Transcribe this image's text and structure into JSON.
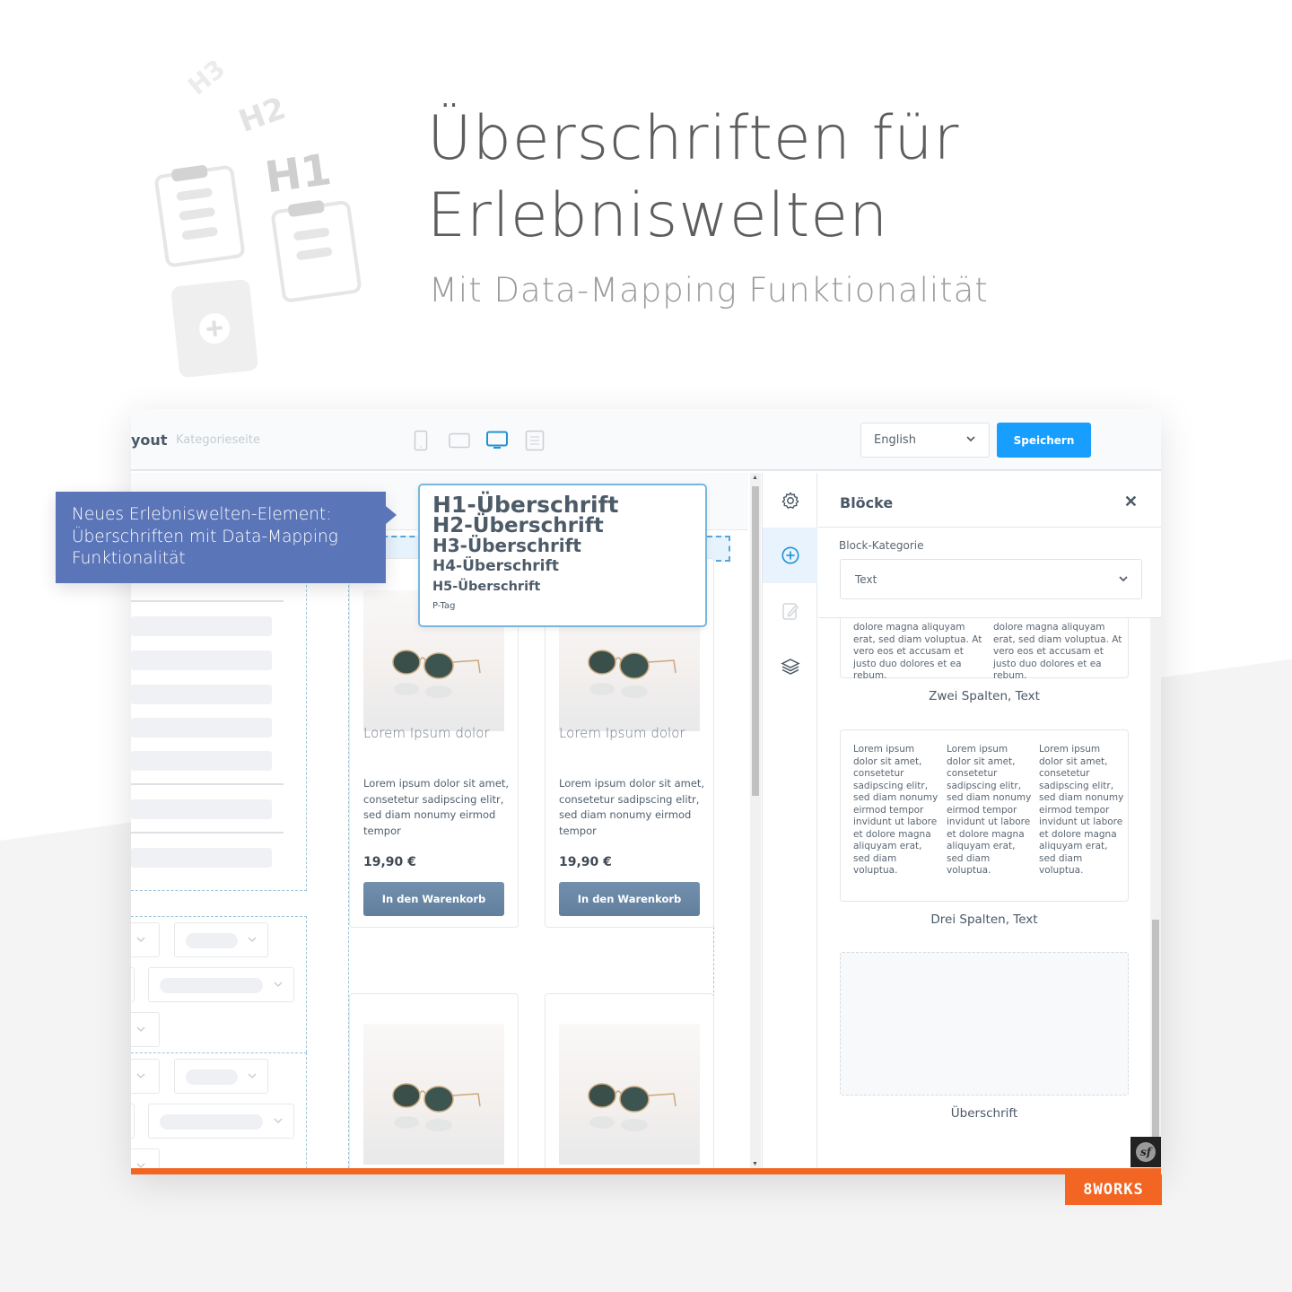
{
  "hero": {
    "title_line1": "Überschriften für",
    "title_line2": "Erlebniswelten",
    "subtitle": "Mit Data-Mapping Funktionalität",
    "illustration_labels": [
      "H3",
      "H2",
      "H1"
    ]
  },
  "header": {
    "title_partial": "yout",
    "breadcrumb": "Kategorieseite",
    "devices": [
      {
        "icon": "smartphone-icon",
        "active": false
      },
      {
        "icon": "tablet-icon",
        "active": false
      },
      {
        "icon": "desktop-icon",
        "active": true
      },
      {
        "icon": "list-view-icon",
        "active": false
      }
    ],
    "language": "English",
    "save_label": "Speichern"
  },
  "callout": {
    "line1": "Neues Erlebniswelten-Element:",
    "line2": "Überschriften mit Data-Mapping",
    "line3": "Funktionalität"
  },
  "heading_dropdown": {
    "options": [
      "H1-Überschrift",
      "H2-Überschrift",
      "H3-Überschrift",
      "H4-Überschrift",
      "H5-Überschrift",
      "P-Tag"
    ]
  },
  "products": [
    {
      "name": "Lorem Ipsum dolor",
      "description": "Lorem ipsum dolor sit amet, consetetur sadipscing elitr, sed diam nonumy eirmod tempor",
      "price": "19,90 €",
      "button": "In den Warenkorb"
    },
    {
      "name": "Lorem Ipsum dolor",
      "description": "Lorem ipsum dolor sit amet, consetetur sadipscing elitr, sed diam nonumy eirmod tempor",
      "price": "19,90 €",
      "button": "In den Warenkorb"
    }
  ],
  "rail": {
    "items": [
      {
        "icon": "gear-icon",
        "active": false
      },
      {
        "icon": "add-circle-icon",
        "active": true
      },
      {
        "icon": "edit-icon",
        "active": false
      },
      {
        "icon": "layers-icon",
        "active": false
      }
    ]
  },
  "blocks_panel": {
    "title": "Blöcke",
    "category_label": "Block-Kategorie",
    "category_value": "Text",
    "blocks": [
      {
        "caption": "Zwei Spalten, Text",
        "columns": [
          "dolore magna aliquyam erat, sed diam voluptua. At vero eos et accusam et justo duo dolores et ea rebum.",
          "dolore magna aliquyam erat, sed diam voluptua. At vero eos et accusam et justo duo dolores et ea rebum."
        ]
      },
      {
        "caption": "Drei Spalten, Text",
        "columns": [
          "Lorem ipsum dolor sit amet, consetetur sadipscing elitr, sed diam nonumy eirmod tempor invidunt ut labore et dolore magna aliquyam erat, sed diam voluptua.",
          "Lorem ipsum dolor sit amet, consetetur sadipscing elitr, sed diam nonumy eirmod tempor invidunt ut labore et dolore magna aliquyam erat, sed diam voluptua.",
          "Lorem ipsum dolor sit amet, consetetur sadipscing elitr, sed diam nonumy eirmod tempor invidunt ut labore et dolore magna aliquyam erat, sed diam voluptua."
        ]
      },
      {
        "caption": "Überschrift",
        "columns": []
      }
    ]
  },
  "footer": {
    "framework_badge": "sf",
    "brand": "8WORKS",
    "brand_color": "#f26522",
    "accent_color": "#189eff",
    "callout_color": "#5b75b9"
  }
}
